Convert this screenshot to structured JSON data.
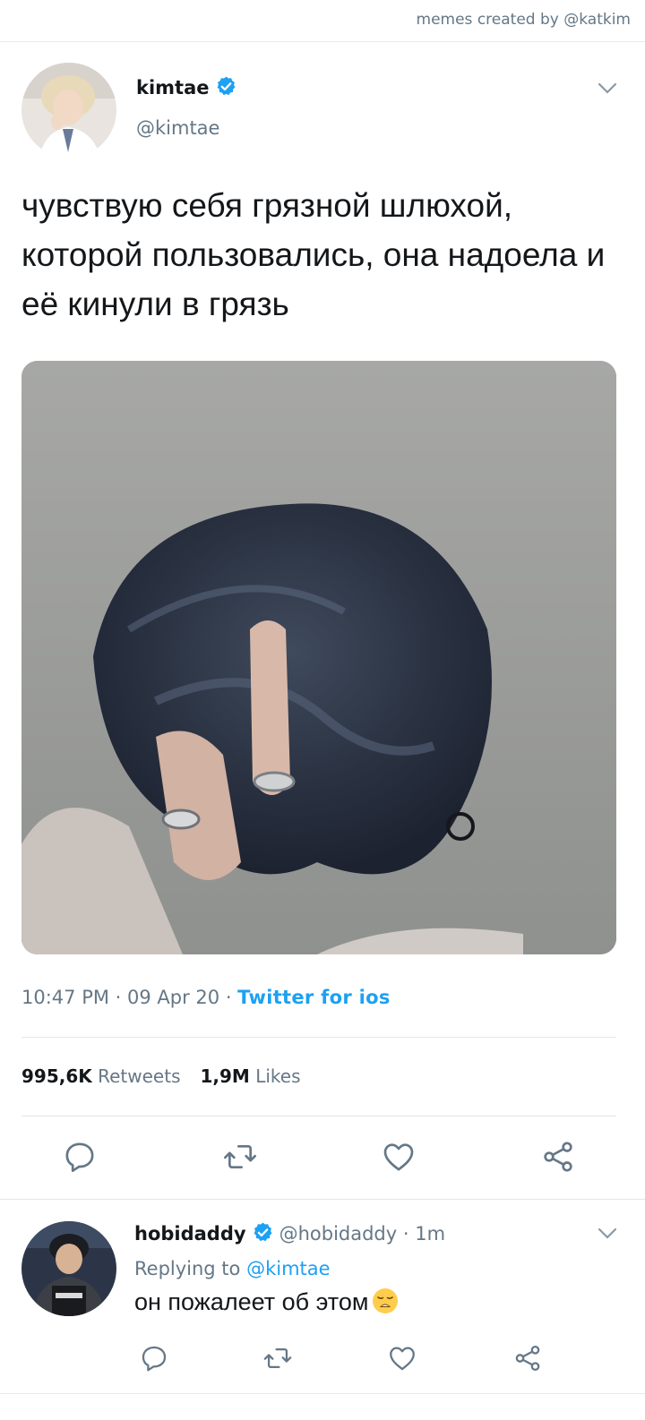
{
  "header": {
    "credit": "memes created by @katkim"
  },
  "tweet": {
    "author_name": "kimtae",
    "author_handle": "@kimtae",
    "text": "чувствую себя грязной шлюхой, которой пользовались, она надоела и её кинули в грязь",
    "time": "10:47 PM",
    "date": "09 Apr 20",
    "source": "Twitter for ios",
    "retweets_count": "995,6K",
    "retweets_label": "Retweets",
    "likes_count": "1,9M",
    "likes_label": "Likes",
    "sep": " · "
  },
  "reply": {
    "author_name": "hobidaddy",
    "author_handle": "@hobidaddy",
    "time": "1m",
    "replying_prefix": "Replying to",
    "replying_to": "@kimtae",
    "text": "он пожалеет об этом"
  },
  "colors": {
    "accent": "#1da1f2",
    "secondary_text": "#657786",
    "primary_text": "#14171a",
    "divider": "#e1e8ed"
  },
  "icons": [
    "verified-badge-icon",
    "chevron-down-icon",
    "reply-icon",
    "retweet-icon",
    "like-icon",
    "share-icon",
    "weary-face-emoji"
  ]
}
